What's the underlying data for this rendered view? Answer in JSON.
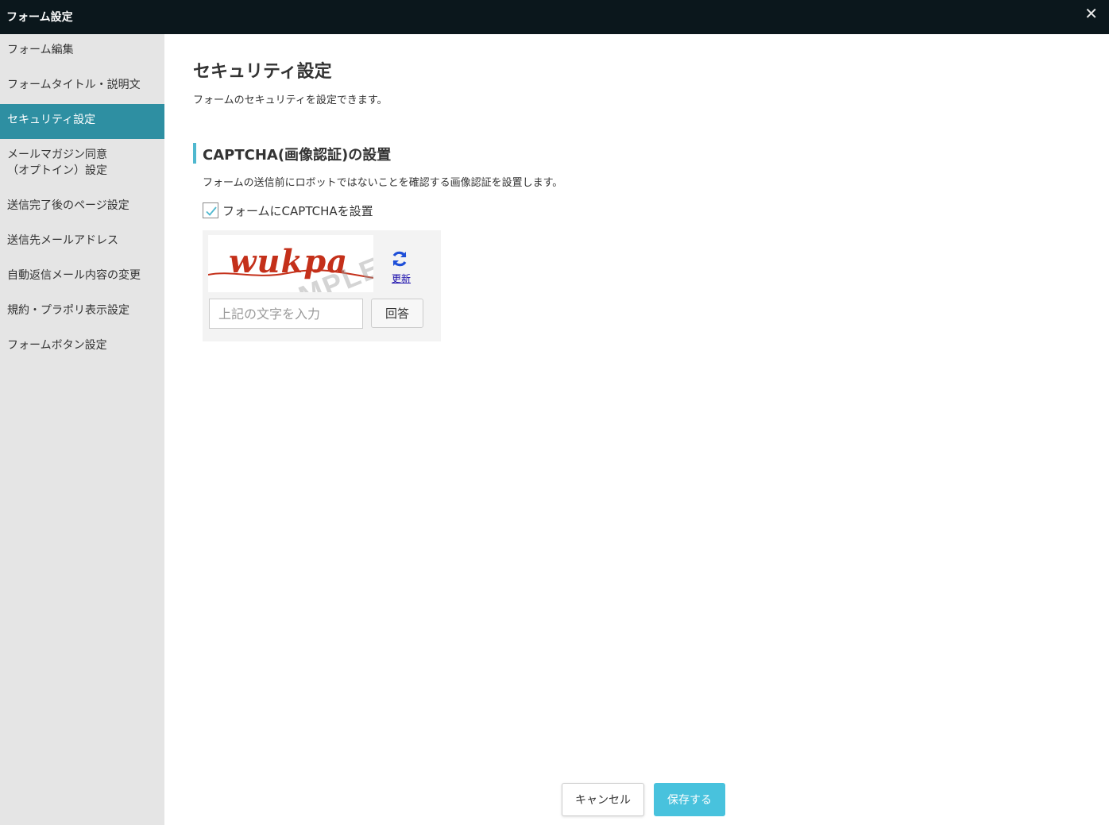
{
  "window": {
    "title": "フォーム設定",
    "close_glyph": "✕"
  },
  "sidebar": {
    "items": [
      {
        "label": "フォーム編集",
        "active": false
      },
      {
        "label": "フォームタイトル・説明文",
        "active": false
      },
      {
        "label": "セキュリティ設定",
        "active": true
      },
      {
        "label": "メールマガジン同意\n（オプトイン）設定",
        "active": false
      },
      {
        "label": "送信完了後のページ設定",
        "active": false
      },
      {
        "label": "送信先メールアドレス",
        "active": false
      },
      {
        "label": "自動返信メール内容の変更",
        "active": false
      },
      {
        "label": "規約・プラポリ表示設定",
        "active": false
      },
      {
        "label": "フォームボタン設定",
        "active": false
      }
    ]
  },
  "main": {
    "title": "セキュリティ設定",
    "description": "フォームのセキュリティを設定できます。",
    "section": {
      "title": "CAPTCHA(画像認証)の設置",
      "description": "フォームの送信前にロボットではないことを確認する画像認証を設置します。",
      "checkbox_label": "フォームにCAPTCHAを設置",
      "checkbox_checked": true
    },
    "captcha": {
      "image_text": "wukpa",
      "watermark": "SAMPLE",
      "refresh_label": "更新",
      "refresh_icon": "refresh-icon",
      "input_placeholder": "上記の文字を入力",
      "input_value": "",
      "answer_label": "回答"
    }
  },
  "footer": {
    "cancel_label": "キャンセル",
    "save_label": "保存する"
  },
  "colors": {
    "titlebar": "#0b171c",
    "sidebar_bg": "#e5e5e5",
    "sidebar_active": "#2e8fa2",
    "accent": "#4fb8cf",
    "save_button": "#48c2dd",
    "captcha_text": "#c4301a",
    "refresh_icon": "#1e4fd8"
  }
}
